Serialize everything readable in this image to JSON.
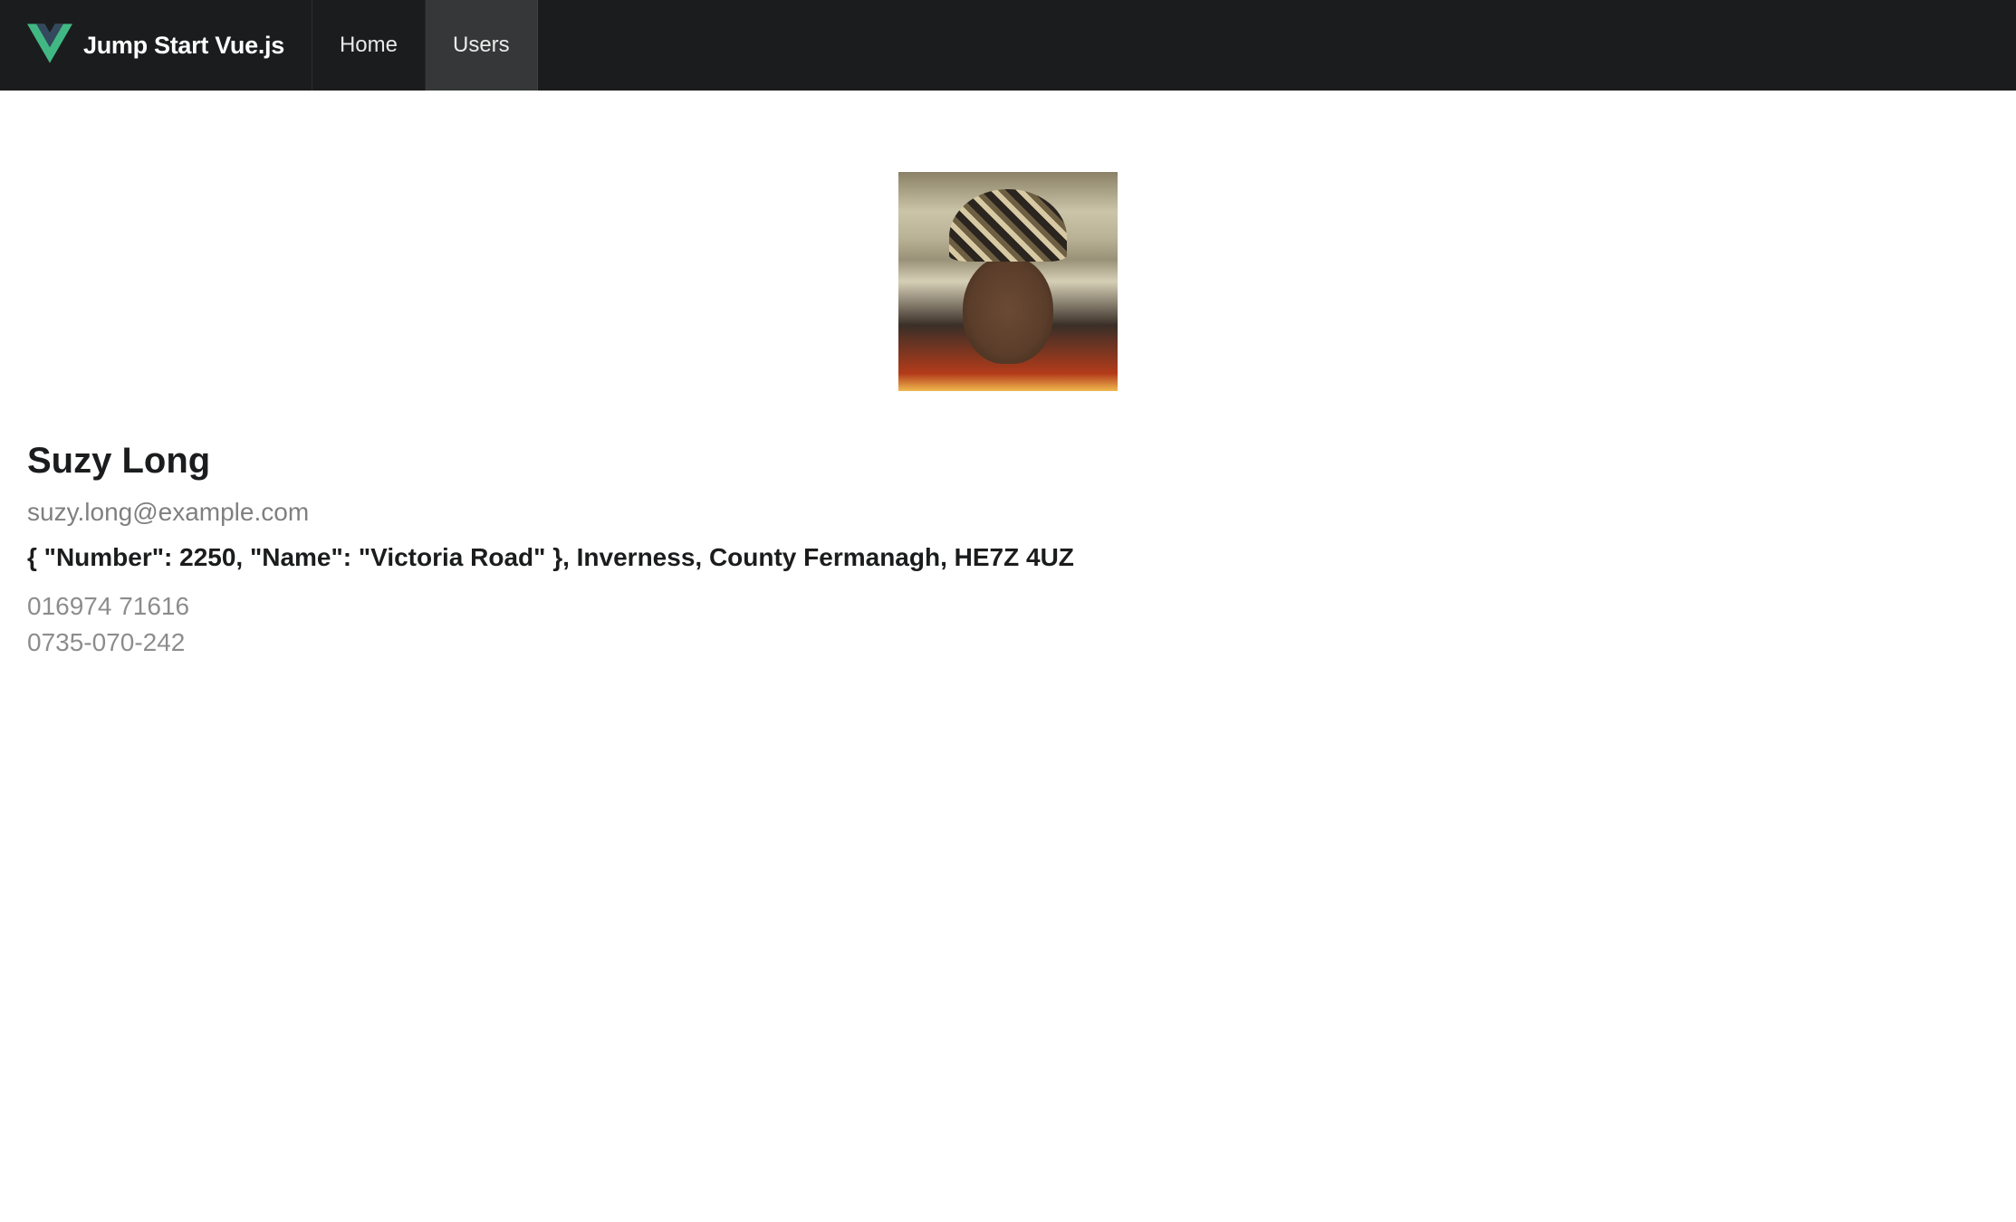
{
  "navbar": {
    "brand": "Jump Start Vue.js",
    "items": [
      {
        "label": "Home",
        "active": false
      },
      {
        "label": "Users",
        "active": true
      }
    ]
  },
  "user": {
    "name": "Suzy Long",
    "email": "suzy.long@example.com",
    "address": "{ \"Number\": 2250, \"Name\": \"Victoria Road\" }, Inverness, County Fermanagh, HE7Z 4UZ",
    "phone": "016974 71616",
    "cell": "0735-070-242"
  }
}
